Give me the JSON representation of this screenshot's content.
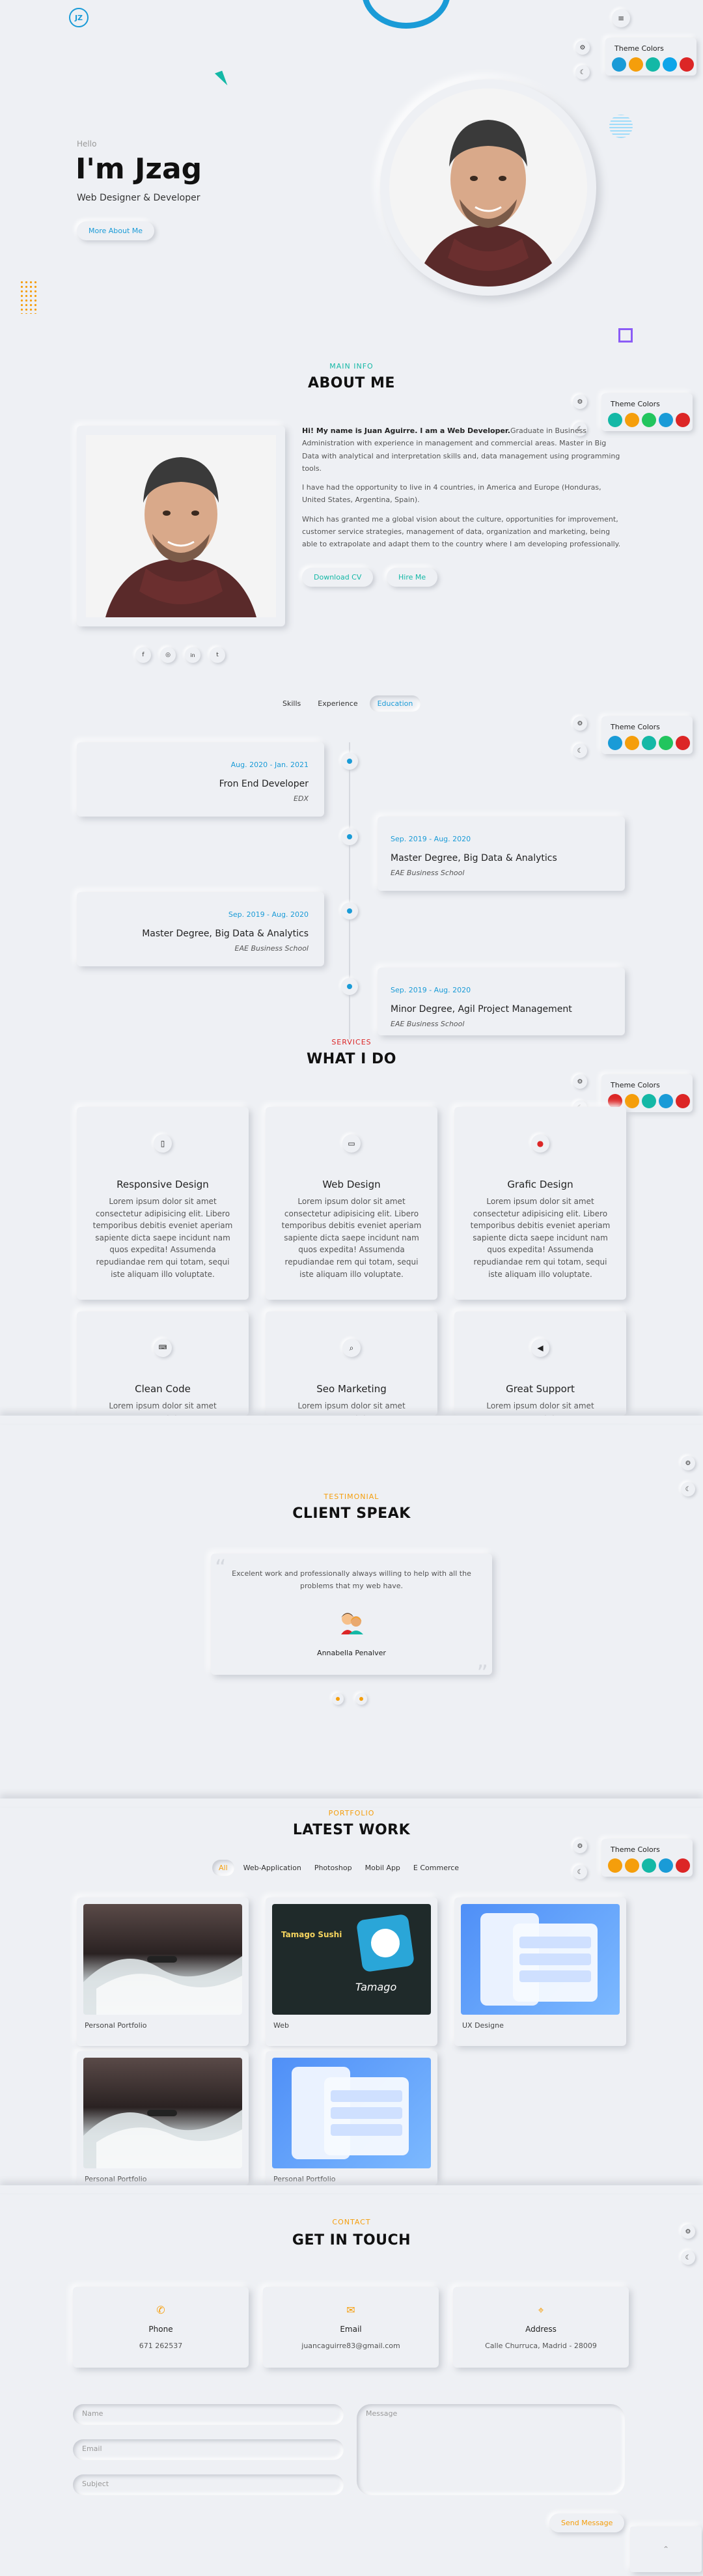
{
  "nav": {
    "logo": "JZ",
    "menu_icon": "menu-icon"
  },
  "theme": {
    "title": "Theme Colors",
    "colors": [
      "#1a9bd7",
      "#f59e0b",
      "#14b8a6",
      "#22c55e",
      "#dc2626"
    ],
    "colors_alt": [
      "#dc2626",
      "#f59e0b",
      "#14b8a6",
      "#1a9bd7",
      "#dc2626"
    ]
  },
  "hero": {
    "hello": "Hello",
    "name": "I'm Jzag",
    "role": "Web Designer & Developer",
    "button": "More About Me"
  },
  "about": {
    "label": "MAIN INFO",
    "title": "ABOUT ME",
    "p1_strong": "Hi! My name is Juan Aguirre. I am a Web Developer.",
    "p1_rest": "Graduate in Business Administration with experience in management and commercial areas. Master in Big Data with analytical and interpretation skills and, data management using programming tools.",
    "p2": "I have had the opportunity to live in 4 countries, in America and Europe (Honduras, United States, Argentina, Spain).",
    "p3": "Which has granted me a global vision about the culture, opportunities for improvement, customer service strategies, management of data, organization and marketing, being able to extrapolate and adapt them to the country where I am developing professionally.",
    "btn_cv": "Download CV",
    "btn_hire": "Hire Me",
    "socials": [
      "facebook-icon",
      "instagram-icon",
      "linkedin-icon",
      "twitter-icon"
    ]
  },
  "resume": {
    "tabs": [
      "Skills",
      "Experience",
      "Education"
    ],
    "active_tab": "Education",
    "items": [
      {
        "date": "Aug. 2020 - Jan. 2021",
        "title": "Fron End Developer",
        "place": "EDX"
      },
      {
        "date": "Sep. 2019 - Aug. 2020",
        "title": "Master Degree, Big Data & Analytics",
        "place": "EAE Business School"
      },
      {
        "date": "Sep. 2019 - Aug. 2020",
        "title": "Master Degree, Big Data & Analytics",
        "place": "EAE Business School"
      },
      {
        "date": "Sep. 2019 - Aug. 2020",
        "title": "Minor Degree, Agil Project Management",
        "place": "EAE Business School"
      }
    ]
  },
  "services": {
    "label": "SERVICES",
    "title": "WHAT I DO",
    "lorem": "Lorem ipsum dolor sit amet consectetur adipisicing elit. Libero temporibus debitis eveniet aperiam sapiente dicta saepe incidunt nam quos expedita! Assumenda repudiandae rem qui totam, sequi iste aliquam illo voluptate.",
    "lorem_short": "Lorem ipsum dolor sit amet consectetur",
    "items": [
      {
        "title": "Responsive Design",
        "icon": "mobile-icon"
      },
      {
        "title": "Web Design",
        "icon": "monitor-icon"
      },
      {
        "title": "Grafic Design",
        "icon": "palette-icon"
      },
      {
        "title": "Clean Code",
        "icon": "code-icon"
      },
      {
        "title": "Seo Marketing",
        "icon": "search-icon"
      },
      {
        "title": "Great Support",
        "icon": "megaphone-icon"
      }
    ]
  },
  "testimonial": {
    "label": "TESTIMONIAL",
    "title": "CLIENT SPEAK",
    "quote": "Excelent work and professionally always willing to help with all the problems that my web have.",
    "author": "Annabella Penalver"
  },
  "portfolio": {
    "label": "PORTFOLIO",
    "title": "LATEST WORK",
    "filters": [
      "All",
      "Web-Application",
      "Photoshop",
      "Mobil App",
      "E Commerce"
    ],
    "active_filter": "All",
    "items": [
      {
        "caption": "Personal Portfolio"
      },
      {
        "caption": "Web"
      },
      {
        "caption": "UX Designe"
      },
      {
        "caption": "Personal Portfolio"
      },
      {
        "caption": "Personal Portfolio"
      }
    ],
    "thumb2_title": "Tamago Sushi",
    "thumb2_logo": "Tamago"
  },
  "contact": {
    "label": "CONTACT",
    "title": "GET IN TOUCH",
    "cards": [
      {
        "title": "Phone",
        "value": "671 262537",
        "icon": "phone-icon"
      },
      {
        "title": "Email",
        "value": "juancaguirre83@gmail.com",
        "icon": "email-icon"
      },
      {
        "title": "Address",
        "value": "Calle Churruca, Madrid - 28009",
        "icon": "location-icon"
      }
    ],
    "name_ph": "Name",
    "email_ph": "Email",
    "subject_ph": "Subject",
    "message_ph": "Message",
    "send": "Send Message"
  }
}
